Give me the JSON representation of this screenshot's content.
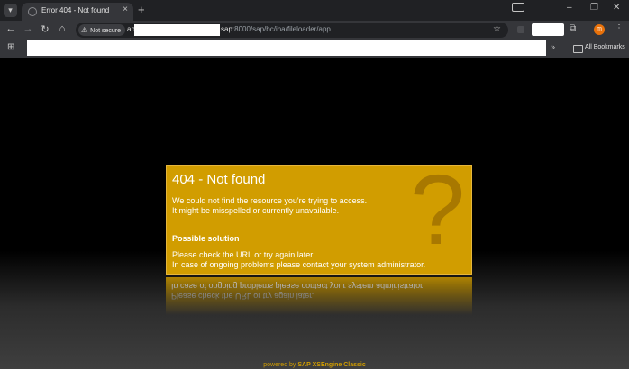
{
  "browser": {
    "tab_title": "Error 404 - Not found",
    "tab_close": "×",
    "new_tab": "+",
    "security_label": "Not secure",
    "url_prefix": "ap",
    "url_host_end": "sap",
    "url_rest": ":8000/sap/bc/ina/fileloader/app",
    "all_bookmarks": "All Bookmarks",
    "profile_initial": "m",
    "icons": [
      "tab-search-icon",
      "back-arrow-icon",
      "forward-arrow-icon",
      "reload-icon",
      "home-icon",
      "warning-icon",
      "star-icon",
      "extensions-icon",
      "kebab-menu-icon",
      "apps-grid-icon",
      "folder-icon",
      "cast-icon"
    ],
    "window_buttons": {
      "minimize": "–",
      "maximize": "❐",
      "close": "✕"
    }
  },
  "error": {
    "title": "404 - Not found",
    "message_lines": [
      "We could not find the resource you're trying to access.",
      "It might be misspelled or currently unavailable."
    ],
    "solution_heading": "Possible solution",
    "solution_lines": [
      "Please check the URL or try again later.",
      "In case of ongoing problems please contact your system administrator."
    ],
    "decor_glyph": "?"
  },
  "footer": {
    "powered_by": "powered by",
    "engine": "SAP XSEngine Classic"
  },
  "colors": {
    "accent": "#d19d00",
    "page_background": "#000000",
    "chrome_dark": "#202124",
    "chrome_toolbar": "#35363a"
  }
}
